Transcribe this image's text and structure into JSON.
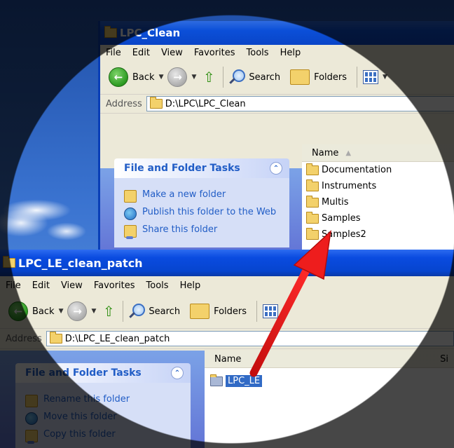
{
  "upper_window": {
    "title": "LPC_Clean",
    "menu": [
      "File",
      "Edit",
      "View",
      "Favorites",
      "Tools",
      "Help"
    ],
    "toolbar": {
      "back": "Back",
      "search": "Search",
      "folders": "Folders"
    },
    "address_label": "Address",
    "address_value": "D:\\LPC\\LPC_Clean",
    "task_panel": {
      "title": "File and Folder Tasks",
      "tasks": [
        "Make a new folder",
        "Publish this folder to the Web",
        "Share this folder"
      ]
    },
    "column_name": "Name",
    "files": [
      "Documentation",
      "Instruments",
      "Multis",
      "Samples",
      "Samples2"
    ]
  },
  "lower_window": {
    "title": "LPC_LE_clean_patch",
    "menu": [
      "File",
      "Edit",
      "View",
      "Favorites",
      "Tools",
      "Help"
    ],
    "toolbar": {
      "back": "Back",
      "search": "Search",
      "folders": "Folders"
    },
    "address_label": "Address",
    "address_value": "D:\\LPC_LE_clean_patch",
    "task_panel": {
      "title": "File and Folder Tasks",
      "tasks": [
        "Rename this folder",
        "Move this folder",
        "Copy this folder"
      ]
    },
    "column_name": "Name",
    "column_size": "Si",
    "files": [
      "LPC_LE"
    ]
  },
  "colors": {
    "xp_title_blue": "#0a4be0",
    "selection_blue": "#316ac5",
    "arrow_red": "#e11b1b",
    "task_link_blue": "#215dc6"
  }
}
